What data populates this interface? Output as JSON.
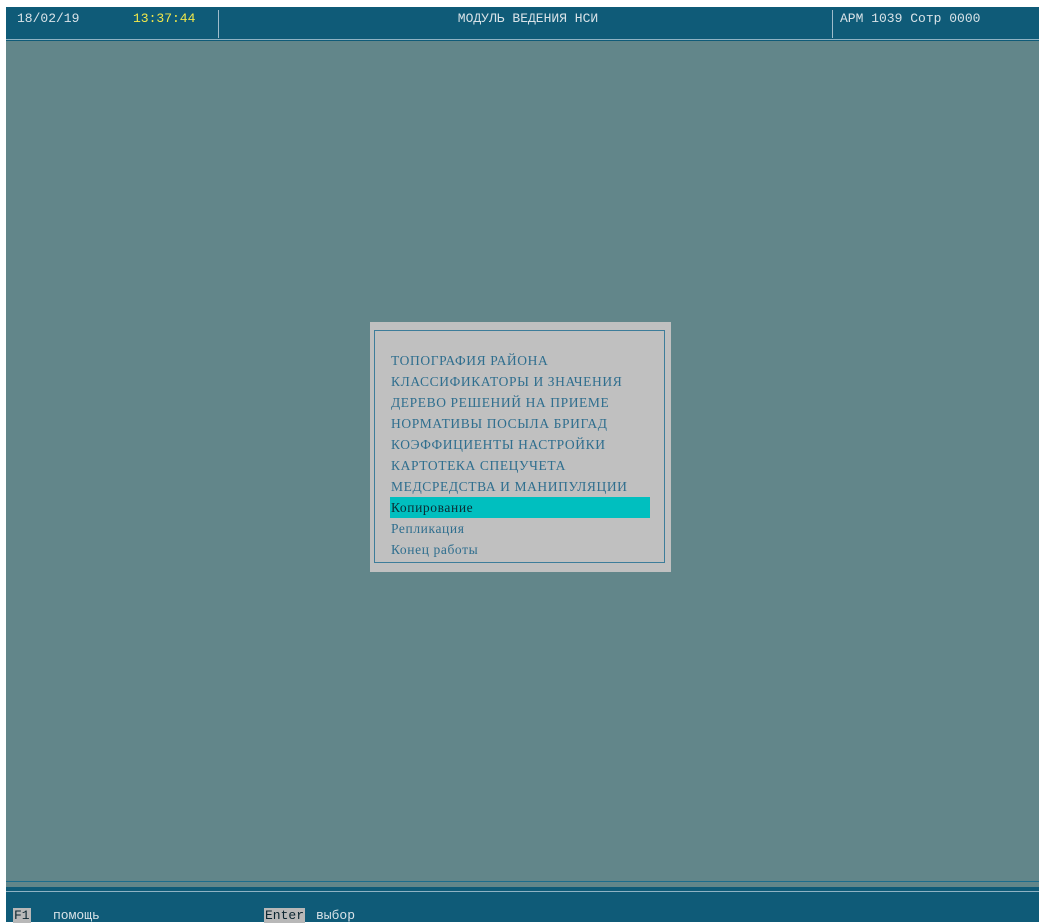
{
  "header": {
    "date": "18/02/19",
    "time": "13:37:44",
    "title": "МОДУЛЬ ВЕДЕНИЯ НСИ",
    "station": "АРМ 1039 Сотр 0000"
  },
  "menu": {
    "items": [
      {
        "label": "ТОПОГРАФИЯ РАЙОНА"
      },
      {
        "label": "КЛАССИФИКАТОРЫ И ЗНАЧЕНИЯ"
      },
      {
        "label": "ДЕРЕВО РЕШЕНИЙ НА ПРИЕМЕ"
      },
      {
        "label": "НОРМАТИВЫ ПОСЫЛА БРИГАД"
      },
      {
        "label": "КОЭФФИЦИЕНТЫ НАСТРОЙКИ"
      },
      {
        "label": "КАРТОТЕКА СПЕЦУЧЕТА"
      },
      {
        "label": "МЕДСРЕДСТВА И МАНИПУЛЯЦИИ"
      },
      {
        "label": "Копирование"
      },
      {
        "label": "Репликация"
      },
      {
        "label": "Конец работы"
      }
    ],
    "selected_index": 7
  },
  "footer": {
    "keys": [
      {
        "key": "F1",
        "label": "помощь"
      },
      {
        "key": "Enter",
        "label": "выбор"
      }
    ]
  },
  "colors": {
    "background": "#62868a",
    "bar": "#0f5b78",
    "time_accent": "#f2e84a",
    "menu_bg": "#c0c0c0",
    "menu_text": "#2f6e8e",
    "selection": "#00bfbf"
  }
}
